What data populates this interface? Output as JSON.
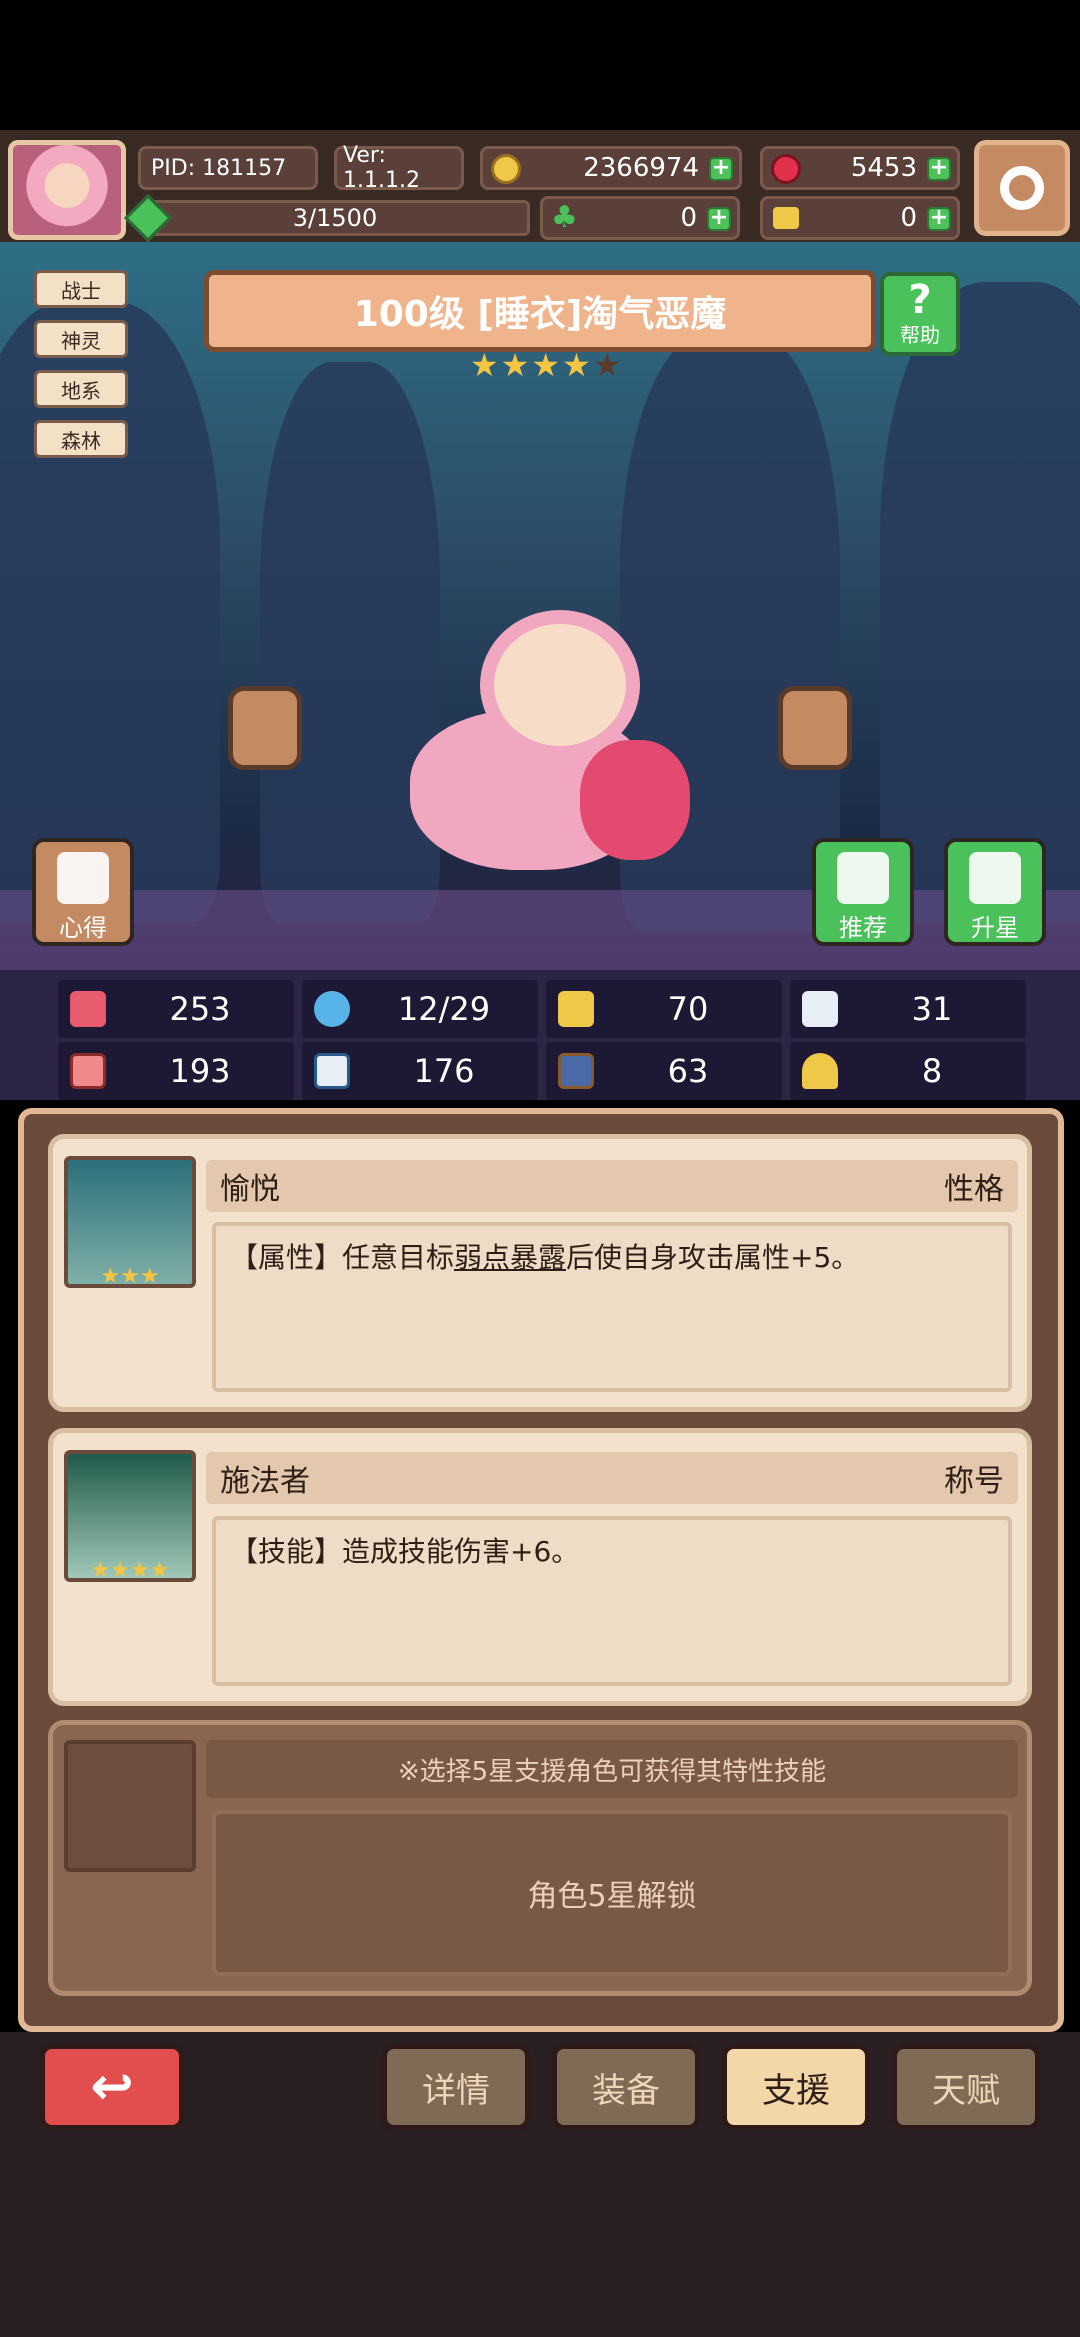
{
  "header": {
    "pid": "PID: 181157",
    "version": "Ver: 1.1.1.2",
    "gold": "2366974",
    "gems": "5453",
    "clover": "0",
    "keys": "0",
    "exp": "3/1500"
  },
  "hero": {
    "tags": [
      "战士",
      "神灵",
      "地系",
      "森林"
    ],
    "title": "100级  [睡衣]淘气恶魔",
    "stars": "★★★★",
    "star_dim": "★",
    "help_label": "帮助",
    "xinde_label": "心得",
    "tuijian_label": "推荐",
    "shengxing_label": "升星"
  },
  "stats": {
    "hp": "253",
    "mp": "12/29",
    "def": "70",
    "speed": "31",
    "atk": "193",
    "magic": "176",
    "resist": "63",
    "luck": "8"
  },
  "cards": [
    {
      "name": "愉悦",
      "type": "性格",
      "stars": "★★★",
      "desc_prefix": "【属性】任意目标",
      "desc_underline": "弱点暴露",
      "desc_suffix": "后使自身攻击属性+5。"
    },
    {
      "name": "施法者",
      "type": "称号",
      "stars": "★★★★",
      "desc": "【技能】造成技能伤害+6。"
    }
  ],
  "support": {
    "note": "※选择5星支援角色可获得其特性技能",
    "lock": "角色5星解锁"
  },
  "tabs": {
    "details": "详情",
    "equip": "装备",
    "support": "支援",
    "talent": "天赋",
    "back_glyph": "↩"
  },
  "colors": {
    "accent_green": "#4ac15a",
    "back_red": "#e24e4e",
    "star": "#f4c542"
  }
}
